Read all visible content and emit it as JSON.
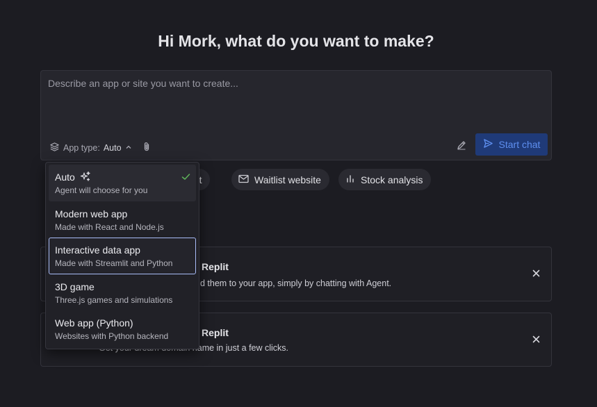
{
  "heading": "Hi Mork, what do you want to make?",
  "prompt": {
    "placeholder": "Describe an app or site you want to create...",
    "value": ""
  },
  "app_type": {
    "label": "App type:",
    "value": "Auto"
  },
  "start_button": "Start chat",
  "chips": [
    {
      "label": "chat",
      "icon": "chat-icon"
    },
    {
      "label": "Waitlist website",
      "icon": "mail-icon"
    },
    {
      "label": "Stock analysis",
      "icon": "bar-chart-icon"
    }
  ],
  "cards": [
    {
      "title": "Replit",
      "desc": "d them to your app, simply by chatting with Agent."
    },
    {
      "title": "Replit",
      "desc": "Get your dream domain name in just a few clicks."
    }
  ],
  "dropdown": {
    "items": [
      {
        "label": "Auto",
        "sub": "Agent will choose for you",
        "selected": true
      },
      {
        "label": "Modern web app",
        "sub": "Made with React and Node.js"
      },
      {
        "label": "Interactive data app",
        "sub": "Made with Streamlit and Python",
        "focused": true
      },
      {
        "label": "3D game",
        "sub": "Three.js games and simulations"
      },
      {
        "label": "Web app (Python)",
        "sub": "Websites with Python backend"
      }
    ]
  },
  "colors": {
    "background": "#1c1c22",
    "start_button_bg": "#1f3a78",
    "start_button_text": "#5e8ff0",
    "check": "#5fb35a",
    "focus_ring": "#a9bdf8"
  }
}
